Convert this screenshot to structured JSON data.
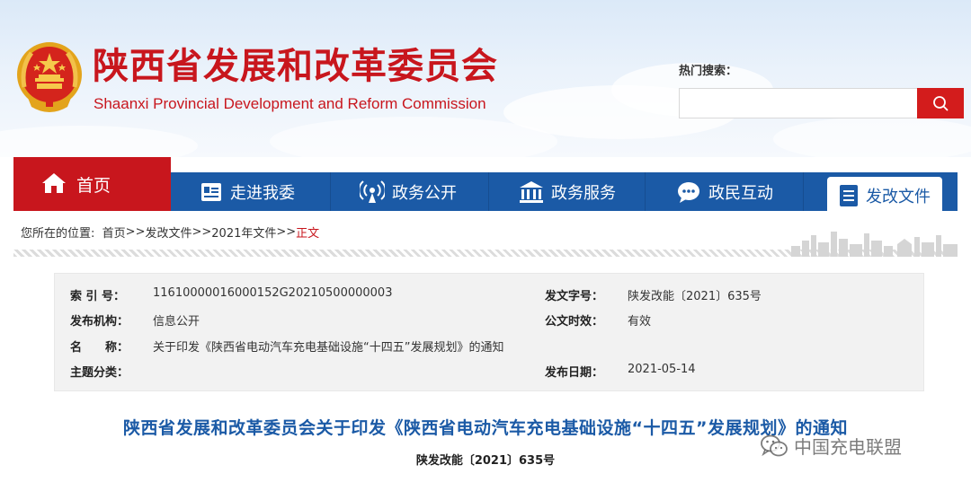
{
  "header": {
    "title_cn": "陕西省发展和改革委员会",
    "title_en": "Shaanxi Provincial Development and Reform Commission"
  },
  "search": {
    "label": "热门搜索：",
    "placeholder": "",
    "button_icon": "search-icon"
  },
  "nav": {
    "home": "首页",
    "items": [
      {
        "label": "走进我委",
        "icon": "id-card-icon"
      },
      {
        "label": "政务公开",
        "icon": "broadcast-icon"
      },
      {
        "label": "政务服务",
        "icon": "building-icon"
      },
      {
        "label": "政民互动",
        "icon": "chat-icon"
      }
    ],
    "active": {
      "label": "发改文件",
      "icon": "document-icon"
    }
  },
  "breadcrumb": {
    "prefix": "您所在的位置:",
    "items": [
      "首页",
      "发改文件",
      "2021年文件"
    ],
    "separator": ">>",
    "current": "正文"
  },
  "info": {
    "index_label": "索 引 号：",
    "index_value": "11610000016000152G20210500000003",
    "docno_label": "发文字号：",
    "docno_value": "陕发改能〔2021〕635号",
    "org_label": "发布机构：",
    "org_value": "信息公开",
    "validity_label": "公文时效：",
    "validity_value": "有效",
    "name_label": "名　　称：",
    "name_value": "关于印发《陕西省电动汽车充电基础设施“十四五”发展规划》的通知",
    "topic_label": "主题分类：",
    "topic_value": "",
    "date_label": "发布日期：",
    "date_value": "2021-05-14"
  },
  "article": {
    "title": "陕西省发展和改革委员会关于印发《陕西省电动汽车充电基础设施“十四五”发展规划》的通知",
    "doc_number": "陕发改能〔2021〕635号"
  },
  "watermark": {
    "text": "中国充电联盟",
    "icon": "wechat-icon"
  },
  "colors": {
    "brand_red": "#c8161d",
    "nav_blue": "#1b5aa6",
    "search_red": "#d31c1c"
  }
}
